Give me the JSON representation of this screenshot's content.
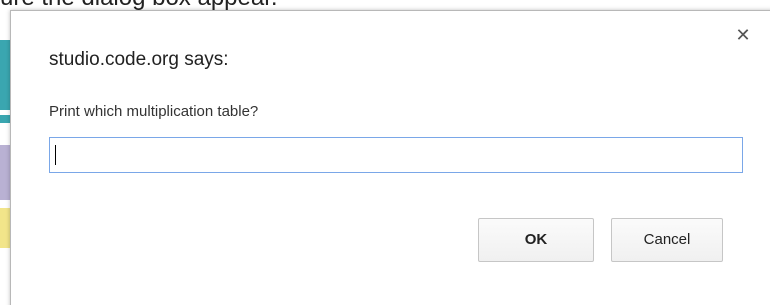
{
  "background": {
    "partial_text": "ure the dialog box appear."
  },
  "dialog": {
    "title": "studio.code.org says:",
    "close_icon": "close-icon",
    "prompt": "Print which multiplication table?",
    "input_value": "",
    "buttons": {
      "ok_label": "OK",
      "cancel_label": "Cancel"
    }
  }
}
